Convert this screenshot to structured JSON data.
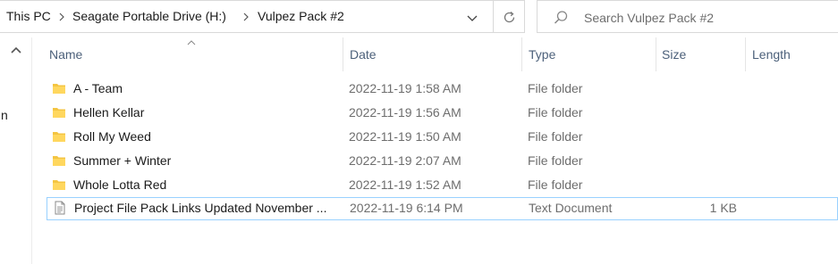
{
  "address_bar": {
    "breadcrumbs": [
      "This PC",
      "Seagate Portable Drive (H:)",
      "Vulpez Pack #2"
    ]
  },
  "search": {
    "placeholder": "Search Vulpez Pack #2"
  },
  "nav_pane": {
    "clipped_text": "n"
  },
  "columns": {
    "name": "Name",
    "date": "Date",
    "type": "Type",
    "size": "Size",
    "length": "Length"
  },
  "files": [
    {
      "name": "A - Team",
      "date": "2022-11-19 1:58 AM",
      "type": "File folder",
      "size": "",
      "icon": "folder-icon"
    },
    {
      "name": "Hellen Kellar",
      "date": "2022-11-19 1:56 AM",
      "type": "File folder",
      "size": "",
      "icon": "folder-icon"
    },
    {
      "name": "Roll My Weed",
      "date": "2022-11-19 1:50 AM",
      "type": "File folder",
      "size": "",
      "icon": "folder-icon"
    },
    {
      "name": "Summer + Winter",
      "date": "2022-11-19 2:07 AM",
      "type": "File folder",
      "size": "",
      "icon": "folder-icon"
    },
    {
      "name": "Whole Lotta Red",
      "date": "2022-11-19 1:52 AM",
      "type": "File folder",
      "size": "",
      "icon": "folder-icon"
    },
    {
      "name": "Project File Pack Links Updated November ...",
      "date": "2022-11-19 6:14 PM",
      "type": "Text Document",
      "size": "1 KB",
      "icon": "text-document-icon"
    }
  ],
  "colors": {
    "folder": "#f4c542",
    "selection_border": "#99d1ff",
    "header_text": "#4c607a"
  }
}
